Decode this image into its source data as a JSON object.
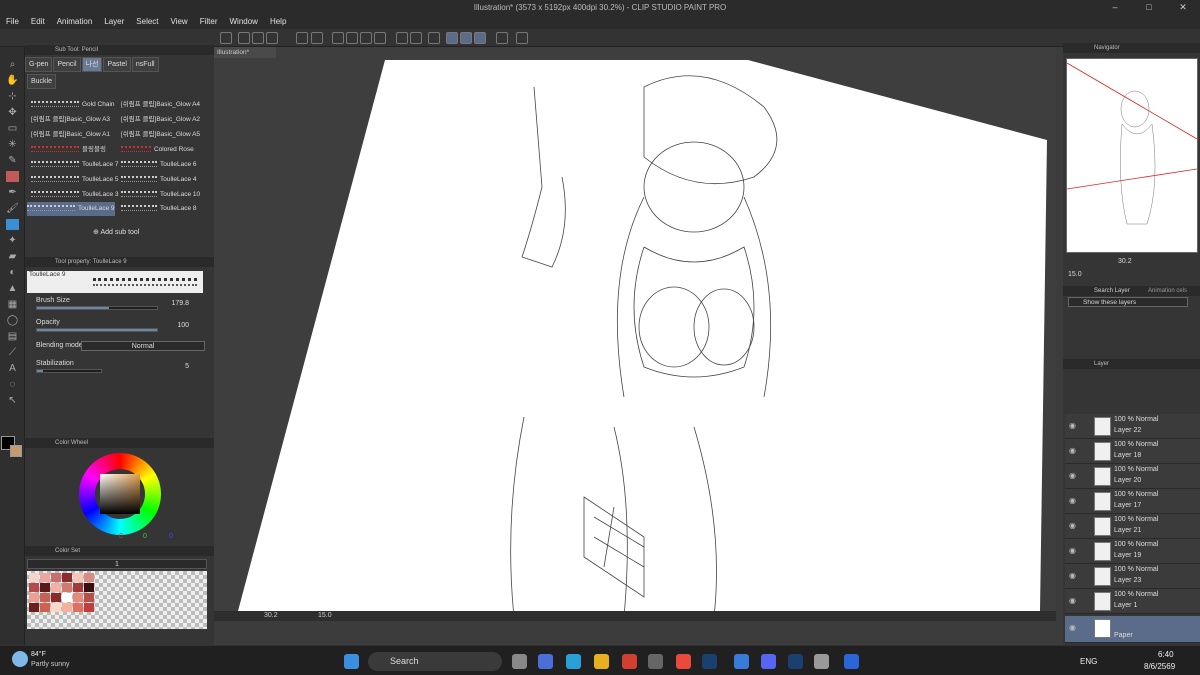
{
  "window": {
    "title": "Illustration* (3573 x 5192px 400dpi 30.2%) - CLIP STUDIO PAINT PRO",
    "controls": [
      "–",
      "□",
      "✕"
    ]
  },
  "menu": [
    "File",
    "Edit",
    "Animation",
    "Layer",
    "Select",
    "View",
    "Filter",
    "Window",
    "Help"
  ],
  "subtool": {
    "header": "Sub Tool: Pencil",
    "tabs": [
      "G-pen",
      "Pencil",
      "나선",
      "Pastel",
      "nsFull"
    ],
    "second_tab": "Buckle",
    "brushes_left": [
      "Gold Chain",
      "[쉬림프 클립]Basic_Glow A3",
      "[쉬림프 클립]Basic_Glow A1",
      "블링블링",
      "ToulleLace 7",
      "ToulleLace 5",
      "ToulleLace 3",
      "ToulleLace 9"
    ],
    "brushes_right": [
      "[쉬림프 클립]Basic_Glow A4",
      "[쉬림프 클립]Basic_Glow A2",
      "[쉬림프 클립]Basic_Glow A5",
      "Colored Rose",
      "ToulleLace 6",
      "ToulleLace 4",
      "ToulleLace 10",
      "ToulleLace 8"
    ],
    "add_label": "Add sub tool"
  },
  "toolprop": {
    "header": "Tool property: ToulleLace 9",
    "preview_name": "ToulleLace 9",
    "brush_size_label": "Brush Size",
    "brush_size_value": "179.8",
    "brush_size_fraction": 0.6,
    "opacity_label": "Opacity",
    "opacity_value": "100",
    "opacity_fraction": 1.0,
    "blend_label": "Blending mode",
    "blend_value": "Normal",
    "stab_label": "Stabilization",
    "stab_value": "5",
    "stab_fraction": 0.1
  },
  "colorwheel": {
    "header": "Color Wheel",
    "r": "0",
    "g": "0",
    "b": "0"
  },
  "colorset": {
    "header": "Color Set",
    "selector": "1",
    "swatches": [
      "#f3d5cc",
      "#e9a7a0",
      "#c96d6d",
      "#8b2d2d",
      "#f7c4b8",
      "#d98c84",
      "#b44a4a",
      "#5a1a1a",
      "#f1b2a6",
      "#cf7b70",
      "#a33a3a",
      "#3a0f0f",
      "#ee9f92",
      "#c46259",
      "#8a2a2a",
      "#ffffff",
      "#e58b7e",
      "#b75049",
      "#6b1f1f",
      "#d06050",
      "#ffd7c8",
      "#f5b0a0",
      "#e07060",
      "#c04040"
    ]
  },
  "document": {
    "tab": "Illustration*"
  },
  "canvas_status": {
    "zoom": "30.2",
    "angle": "15.0"
  },
  "navigator": {
    "header": "Navigator",
    "zoom": "30.2",
    "angle": "15.0"
  },
  "search": {
    "header": "Search Layer",
    "tab2": "Animation cels",
    "filter": "Show these layers"
  },
  "layer_panel": {
    "header": "Layer",
    "layers": [
      {
        "blend": "100 % Normal",
        "name": "Layer 22"
      },
      {
        "blend": "100 % Normal",
        "name": "Layer 18"
      },
      {
        "blend": "100 % Normal",
        "name": "Layer 20"
      },
      {
        "blend": "100 % Normal",
        "name": "Layer 17"
      },
      {
        "blend": "100 % Normal",
        "name": "Layer 21"
      },
      {
        "blend": "100 % Normal",
        "name": "Layer 19"
      },
      {
        "blend": "100 % Normal",
        "name": "Layer 23"
      },
      {
        "blend": "100 % Normal",
        "name": "Layer 1"
      }
    ],
    "paper": "Paper"
  },
  "taskbar": {
    "weather_temp": "84°F",
    "weather_desc": "Partly sunny",
    "search": "Search",
    "lang": "ENG",
    "time": "6:40",
    "date": "8/6/2569"
  }
}
